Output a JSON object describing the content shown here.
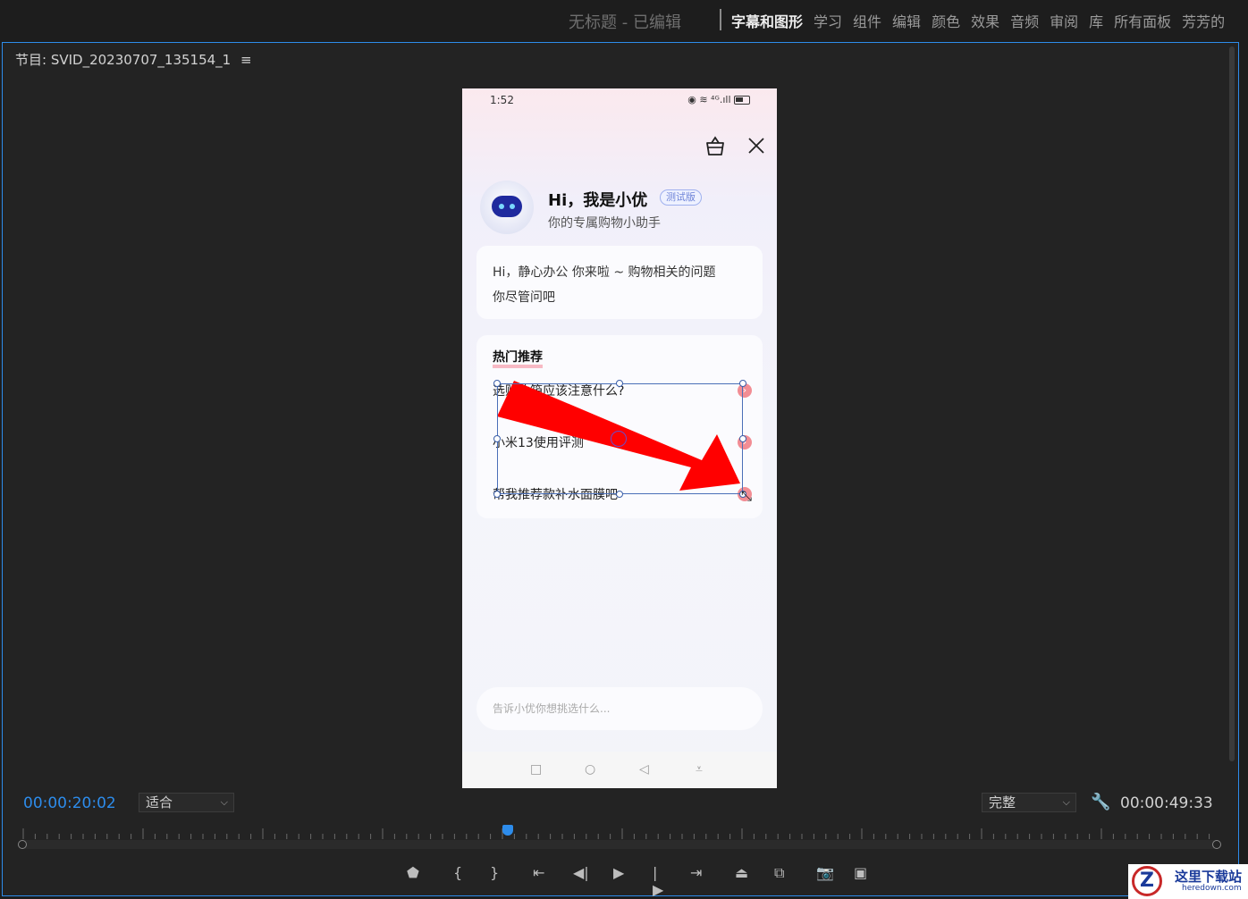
{
  "topbar": {
    "project_title": "无标题 - 已编辑",
    "workspaces": [
      "字幕和图形",
      "学习",
      "组件",
      "编辑",
      "颜色",
      "效果",
      "音频",
      "审阅",
      "库",
      "所有面板",
      "芳芳的"
    ],
    "active_workspace": "字幕和图形"
  },
  "monitor": {
    "title": "节目: SVID_20230707_135154_1",
    "menu_icon": "≡"
  },
  "phone": {
    "status_time": "1:52",
    "status_icons": "◉ ≋ ⁴ᴳ.ıll",
    "greeting_title": "Hi，我是小优",
    "beta_badge": "测试版",
    "greeting_subtitle": "你的专属购物小助手",
    "welcome_line1": "Hi，静心办公 你来啦 ~ 购物相关的问题",
    "welcome_line2": "你尽管问吧",
    "hot_title": "热门推荐",
    "hot_items": [
      "选购冰箱应该注意什么?",
      "小米13使用评测",
      "帮我推荐款补水面膜吧"
    ],
    "input_placeholder": "告诉小优你想挑选什么...",
    "nav": [
      "□",
      "○",
      "◁",
      "⩡"
    ]
  },
  "transport": {
    "current_timecode": "00:00:20:02",
    "zoom_value": "适合",
    "quality_value": "完整",
    "duration_timecode": "00:00:49:33",
    "playhead_fraction": 0.406
  },
  "colors": {
    "accent": "#2d8ceb",
    "arrow_red": "#ff0000",
    "badge_blue": "#6e84d8"
  },
  "watermark": {
    "cn": "这里下载站",
    "en": "heredown.com",
    "logo_letter": "Z"
  }
}
